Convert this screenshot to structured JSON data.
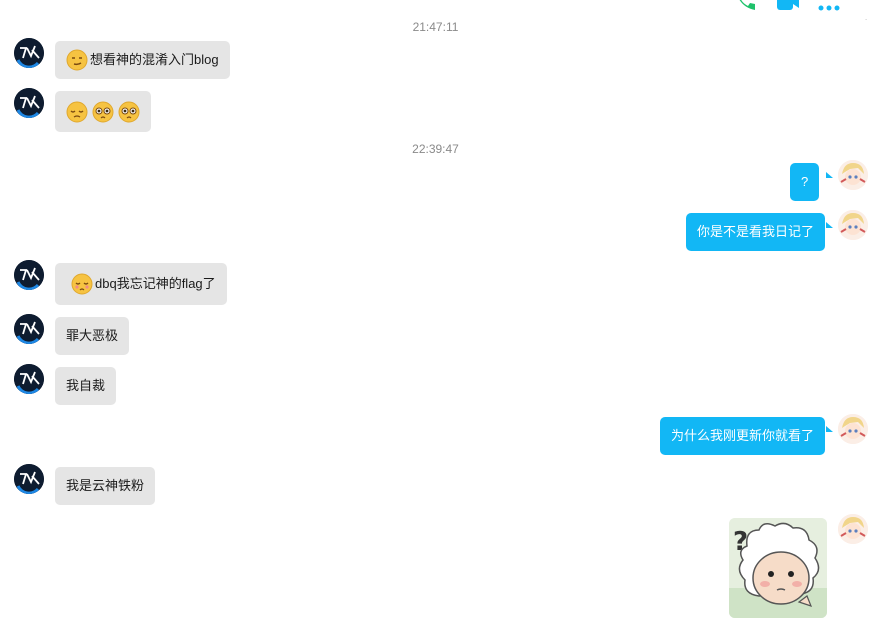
{
  "header": {
    "phone_icon": "phone-icon",
    "video_icon": "video-call-icon",
    "more_icon": "more-icon"
  },
  "colors": {
    "incoming_bubble": "#e5e5e5",
    "outgoing_bubble": "#12b7f5",
    "timestamp": "#8a8a8a"
  },
  "messages": [
    {
      "type": "timestamp",
      "text": "21:47:11"
    },
    {
      "type": "incoming",
      "emoji": "smirk-emoji",
      "text": "想看神的混淆入门blog"
    },
    {
      "type": "incoming",
      "emoji": "disappointed-emoji, pleading-emoji, pleading-emoji",
      "text": ""
    },
    {
      "type": "timestamp",
      "text": "22:39:47"
    },
    {
      "type": "outgoing",
      "text": "?"
    },
    {
      "type": "outgoing",
      "text": "你是不是看我日记了"
    },
    {
      "type": "incoming",
      "emoji": "pleading-emoji",
      "text": "dbq我忘记神的flag了"
    },
    {
      "type": "incoming",
      "text": "罪大恶极"
    },
    {
      "type": "incoming",
      "text": "我自裁"
    },
    {
      "type": "outgoing",
      "text": "为什么我刚更新你就看了"
    },
    {
      "type": "incoming",
      "text": "我是云神铁粉"
    },
    {
      "type": "outgoing",
      "sticker": "sheep-sticker"
    }
  ]
}
